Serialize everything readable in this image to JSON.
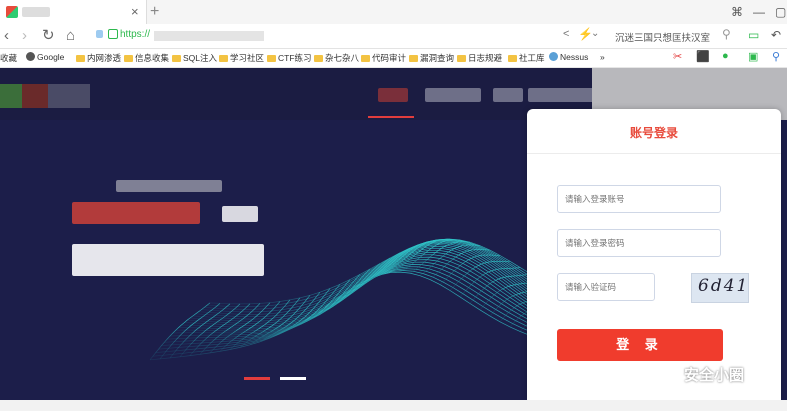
{
  "browser": {
    "tab_close": "×",
    "new_tab": "+",
    "url_prefix": "https://",
    "suggestion": "沉迷三国只想匡扶汉室",
    "window_controls": [
      "⌘",
      "—",
      "▢"
    ]
  },
  "bookmarks": [
    {
      "label": "收藏",
      "type": "text"
    },
    {
      "label": "Google",
      "type": "google"
    },
    {
      "label": "内网渗透",
      "type": "folder"
    },
    {
      "label": "信息收集",
      "type": "folder"
    },
    {
      "label": "SQL注入",
      "type": "folder"
    },
    {
      "label": "学习社区",
      "type": "folder"
    },
    {
      "label": "CTF练习",
      "type": "folder"
    },
    {
      "label": "杂七杂八",
      "type": "folder"
    },
    {
      "label": "代码审计",
      "type": "folder"
    },
    {
      "label": "漏洞查询",
      "type": "folder"
    },
    {
      "label": "日志规避",
      "type": "folder"
    },
    {
      "label": "社工库",
      "type": "folder"
    },
    {
      "label": "Nessus",
      "type": "nessus"
    },
    {
      "label": "»",
      "type": "text"
    }
  ],
  "login": {
    "title": "账号登录",
    "account_placeholder": "请输入登录账号",
    "password_placeholder": "请输入登录密码",
    "captcha_placeholder": "请输入验证码",
    "captcha_text": "6d41",
    "submit_label": "登 录"
  },
  "watermark": "安全小圈",
  "colors": {
    "accent": "#f03c2d",
    "page_bg": "#1c1e4a",
    "wave": "#2fc4c8"
  }
}
